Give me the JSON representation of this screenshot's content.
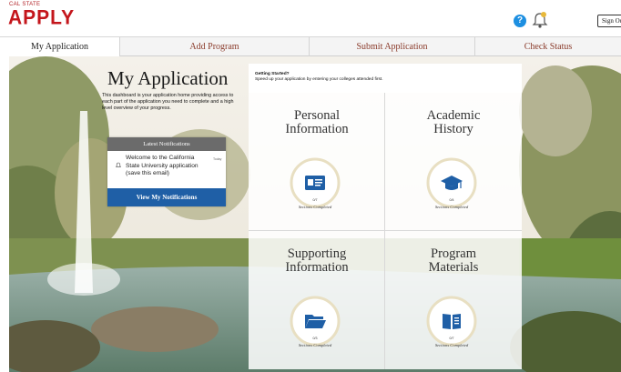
{
  "header": {
    "logo_tagline": "CAL STATE",
    "logo_text": "APPLY",
    "help_label": "?",
    "signout_label": "Sign Out"
  },
  "nav": {
    "tabs": [
      {
        "label": "My Application",
        "active": true
      },
      {
        "label": "Add Program"
      },
      {
        "label": "Submit Application"
      },
      {
        "label": "Check Status"
      }
    ]
  },
  "intro": {
    "title": "My Application",
    "description": "This dashboard is your application home providing access to each part of the application you need to complete and a high level overview of your progress."
  },
  "notifications": {
    "header": "Latest Notifications",
    "items": [
      {
        "text": "Welcome to the California State University application (save this email)",
        "time": "Today"
      }
    ],
    "button": "View My Notifications"
  },
  "getting_started": {
    "title": "Getting Started?",
    "text": "Speed up your application by entering your colleges attended first."
  },
  "sections": [
    {
      "title_line1": "Personal",
      "title_line2": "Information",
      "count": "0/7",
      "caption": "Sections Completed",
      "icon": "id-card-icon"
    },
    {
      "title_line1": "Academic",
      "title_line2": "History",
      "count": "0/4",
      "caption": "Sections Completed",
      "icon": "graduation-cap-icon"
    },
    {
      "title_line1": "Supporting",
      "title_line2": "Information",
      "count": "0/3",
      "caption": "Sections Completed",
      "icon": "folder-icon"
    },
    {
      "title_line1": "Program",
      "title_line2": "Materials",
      "count": "0/7",
      "caption": "Sections Completed",
      "icon": "book-icon"
    }
  ],
  "colors": {
    "brand_red": "#c4161c",
    "nav_link": "#8a3b2b",
    "notif_button": "#1f5fa6",
    "icon_blue": "#1f5fa6",
    "progress_ring": "#e8dfc2"
  }
}
